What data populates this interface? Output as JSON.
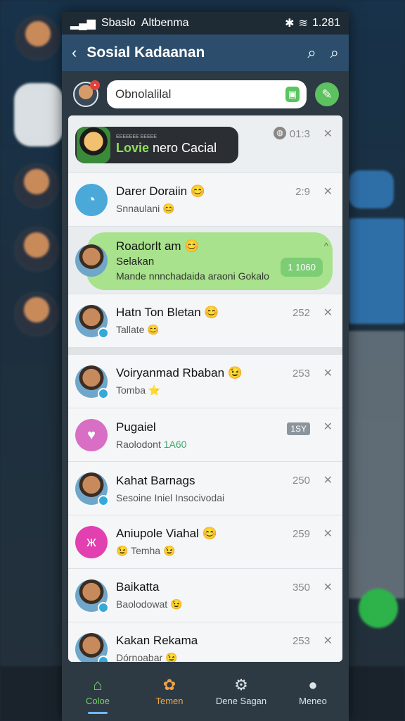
{
  "status": {
    "carrier": "Sbaslo",
    "network": "Altbenma",
    "time": "1.281"
  },
  "appbar": {
    "title": "Sosial Kadaanan"
  },
  "search": {
    "value": "Obnolalilal"
  },
  "promo": {
    "small_text": "ΕΕΕΕΕΕΕ ΕΕΕΕΕ",
    "green_text": "Lovie",
    "white_text": "nero Cacial",
    "time": "01:3"
  },
  "chats": [
    {
      "name": "Darer Doraiin 😊",
      "sub": "Snnaulani 😊",
      "time": "2:9"
    },
    {
      "name": "Hatn Ton Bletan 😊",
      "sub": "Tallate 😊",
      "time": "252"
    },
    {
      "name": "Voiryanmad Rbaban 😉",
      "sub": "Tomba ⭐",
      "time": "253"
    },
    {
      "name": "Pugaiel",
      "sub": "Raolodont",
      "sub_extra": "1A60",
      "tag": "1SY"
    },
    {
      "name": "Kahat Barnags",
      "sub": "Sesoine Iniel Insocivodai",
      "time": "250"
    },
    {
      "name": "Aniupole Viahal 😊",
      "sub": "😉 Temha 😉",
      "time": "259"
    },
    {
      "name": "Baikatta",
      "sub": "Baolodowat 😉",
      "time": "350"
    },
    {
      "name": "Kakan Rekama",
      "sub": "Dórnoabar 😉",
      "time": "253"
    }
  ],
  "highlight": {
    "name": "Roadorlt am 😊",
    "sub1": "Selakan",
    "sub2": "Mande nnnchadaida araoni Gokalo",
    "button": "1 1060"
  },
  "nav": [
    {
      "label": "Coloe",
      "icon": "home-icon"
    },
    {
      "label": "Temen",
      "icon": "friends-icon"
    },
    {
      "label": "Dene Sagan",
      "icon": "settings-icon"
    },
    {
      "label": "Meneo",
      "icon": "person-icon"
    }
  ],
  "colors": {
    "accent": "#2c4e6c",
    "green": "#5cc15f",
    "highlight": "#a9e28d"
  }
}
